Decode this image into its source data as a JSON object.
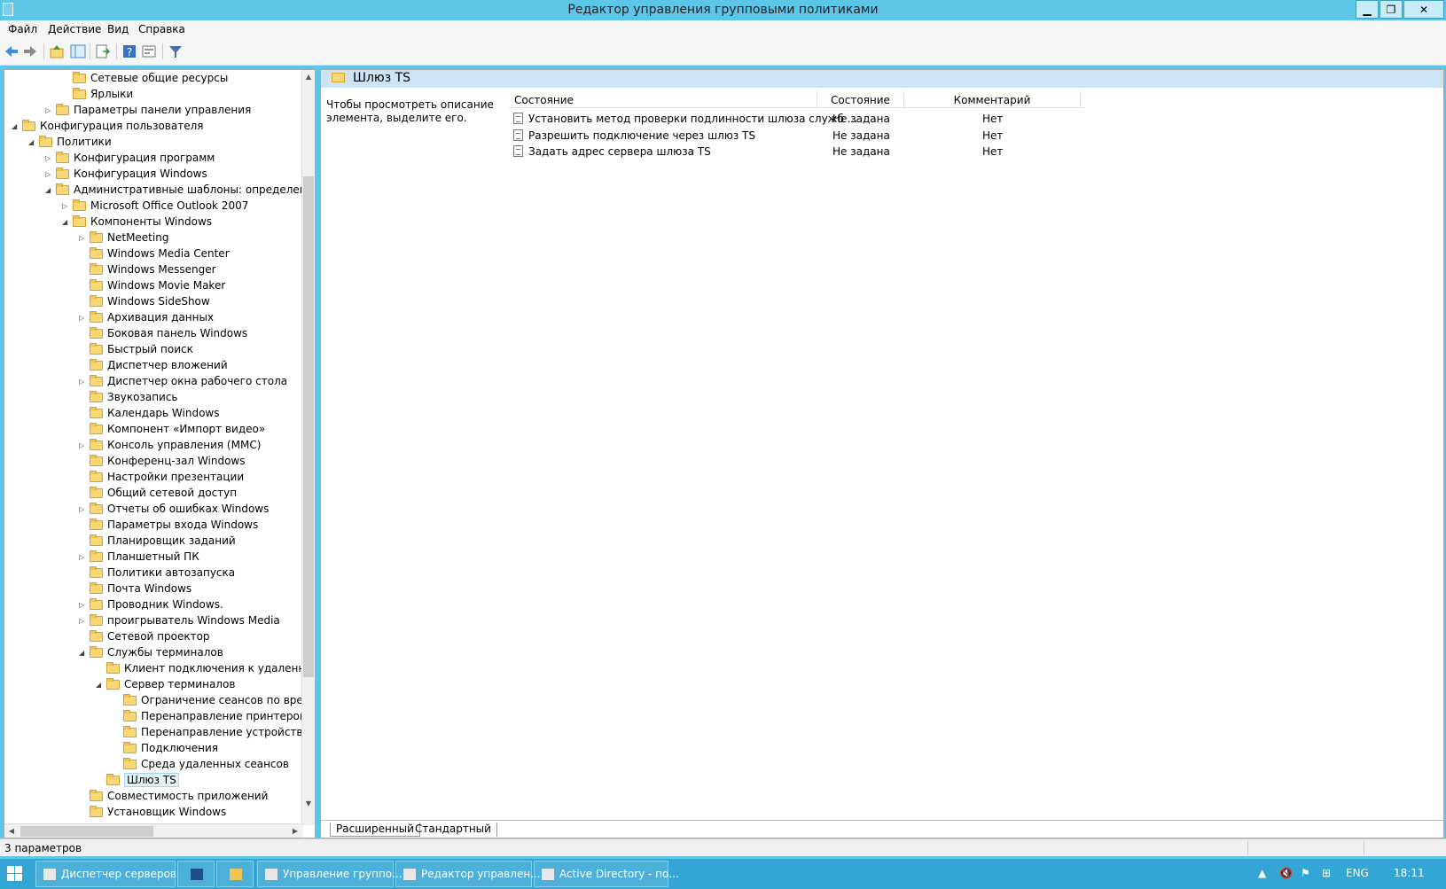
{
  "window": {
    "title": "Редактор управления групповыми политиками",
    "controls": {
      "min": "▁",
      "max": "❐",
      "close": "✕"
    }
  },
  "menu": [
    "Файл",
    "Действие",
    "Вид",
    "Справка"
  ],
  "tree": [
    {
      "label": "Сетевые общие ресурсы",
      "level": 4,
      "expander": "",
      "icon": "share-icon"
    },
    {
      "label": "Ярлыки",
      "level": 4,
      "expander": "",
      "icon": "shortcut-icon"
    },
    {
      "label": "Параметры панели управления",
      "level": 3,
      "expander": "▷",
      "icon": "control-panel-icon"
    },
    {
      "label": "Конфигурация пользователя",
      "level": 1,
      "expander": "◢",
      "icon": "user-config-icon"
    },
    {
      "label": "Политики",
      "level": 2,
      "expander": "◢",
      "icon": "folder-icon"
    },
    {
      "label": "Конфигурация программ",
      "level": 3,
      "expander": "▷",
      "icon": "folder-icon"
    },
    {
      "label": "Конфигурация Windows",
      "level": 3,
      "expander": "▷",
      "icon": "folder-icon"
    },
    {
      "label": "Административные шаблоны: определения п",
      "level": 3,
      "expander": "◢",
      "icon": "folder-icon"
    },
    {
      "label": "Microsoft Office Outlook 2007",
      "level": 4,
      "expander": "▷",
      "icon": "folder-icon"
    },
    {
      "label": "Компоненты Windows",
      "level": 4,
      "expander": "◢",
      "icon": "folder-icon"
    },
    {
      "label": "NetMeeting",
      "level": 5,
      "expander": "▷",
      "icon": "folder-icon"
    },
    {
      "label": "Windows Media Center",
      "level": 5,
      "expander": "",
      "icon": "folder-icon"
    },
    {
      "label": "Windows Messenger",
      "level": 5,
      "expander": "",
      "icon": "folder-icon"
    },
    {
      "label": "Windows Movie Maker",
      "level": 5,
      "expander": "",
      "icon": "folder-icon"
    },
    {
      "label": "Windows SideShow",
      "level": 5,
      "expander": "",
      "icon": "folder-icon"
    },
    {
      "label": "Архивация данных",
      "level": 5,
      "expander": "▷",
      "icon": "folder-icon"
    },
    {
      "label": "Боковая панель Windows",
      "level": 5,
      "expander": "",
      "icon": "folder-icon"
    },
    {
      "label": "Быстрый поиск",
      "level": 5,
      "expander": "",
      "icon": "folder-icon"
    },
    {
      "label": "Диспетчер вложений",
      "level": 5,
      "expander": "",
      "icon": "folder-icon"
    },
    {
      "label": "Диспетчер окна рабочего стола",
      "level": 5,
      "expander": "▷",
      "icon": "folder-icon"
    },
    {
      "label": "Звукозапись",
      "level": 5,
      "expander": "",
      "icon": "folder-icon"
    },
    {
      "label": "Календарь Windows",
      "level": 5,
      "expander": "",
      "icon": "folder-icon"
    },
    {
      "label": "Компонент «Импорт видео»",
      "level": 5,
      "expander": "",
      "icon": "folder-icon"
    },
    {
      "label": "Консоль управления (MMC)",
      "level": 5,
      "expander": "▷",
      "icon": "folder-icon"
    },
    {
      "label": "Конференц-зал Windows",
      "level": 5,
      "expander": "",
      "icon": "folder-icon"
    },
    {
      "label": "Настройки презентации",
      "level": 5,
      "expander": "",
      "icon": "folder-icon"
    },
    {
      "label": "Общий сетевой доступ",
      "level": 5,
      "expander": "",
      "icon": "folder-icon"
    },
    {
      "label": "Отчеты об ошибках Windows",
      "level": 5,
      "expander": "▷",
      "icon": "folder-icon"
    },
    {
      "label": "Параметры входа Windows",
      "level": 5,
      "expander": "",
      "icon": "folder-icon"
    },
    {
      "label": "Планировщик заданий",
      "level": 5,
      "expander": "",
      "icon": "folder-icon"
    },
    {
      "label": "Планшетный ПК",
      "level": 5,
      "expander": "▷",
      "icon": "folder-icon"
    },
    {
      "label": "Политики автозапуска",
      "level": 5,
      "expander": "",
      "icon": "folder-icon"
    },
    {
      "label": "Почта Windows",
      "level": 5,
      "expander": "",
      "icon": "folder-icon"
    },
    {
      "label": "Проводник Windows.",
      "level": 5,
      "expander": "▷",
      "icon": "folder-icon"
    },
    {
      "label": "проигрыватель Windows Media",
      "level": 5,
      "expander": "▷",
      "icon": "folder-icon"
    },
    {
      "label": "Сетевой проектор",
      "level": 5,
      "expander": "",
      "icon": "folder-icon"
    },
    {
      "label": "Службы терминалов",
      "level": 5,
      "expander": "◢",
      "icon": "folder-icon"
    },
    {
      "label": "Клиент подключения к удаленному",
      "level": 6,
      "expander": "",
      "icon": "folder-icon"
    },
    {
      "label": "Сервер терминалов",
      "level": 6,
      "expander": "◢",
      "icon": "folder-icon"
    },
    {
      "label": "Ограничение сеансов по времен",
      "level": 7,
      "expander": "",
      "icon": "folder-icon"
    },
    {
      "label": "Перенаправление принтеров",
      "level": 7,
      "expander": "",
      "icon": "folder-icon"
    },
    {
      "label": "Перенаправление устройств и р",
      "level": 7,
      "expander": "",
      "icon": "folder-icon"
    },
    {
      "label": "Подключения",
      "level": 7,
      "expander": "",
      "icon": "folder-icon"
    },
    {
      "label": "Среда удаленных сеансов",
      "level": 7,
      "expander": "",
      "icon": "folder-icon"
    },
    {
      "label": "Шлюз TS",
      "level": 6,
      "expander": "",
      "icon": "folder-icon",
      "selected": true
    },
    {
      "label": "Совместимость приложений",
      "level": 5,
      "expander": "",
      "icon": "folder-icon"
    },
    {
      "label": "Установщик Windows",
      "level": 5,
      "expander": "",
      "icon": "folder-icon"
    }
  ],
  "right": {
    "header_title": "Шлюз TS",
    "description": "Чтобы просмотреть описание элемента, выделите его.",
    "columns": [
      "Состояние",
      "Состояние",
      "Комментарий"
    ],
    "rows": [
      {
        "name": "Установить метод проверки подлинности шлюза служб ...",
        "state": "Не задана",
        "comment": "Нет"
      },
      {
        "name": "Разрешить подключение через шлюз TS",
        "state": "Не задана",
        "comment": "Нет"
      },
      {
        "name": "Задать адрес сервера шлюза TS",
        "state": "Не задана",
        "comment": "Нет"
      }
    ],
    "tabs": [
      "Расширенный",
      "Стандартный"
    ]
  },
  "status": {
    "text": "3 параметров"
  },
  "taskbar": {
    "items": [
      {
        "label": "Диспетчер серверов",
        "icon": "server-manager-icon"
      },
      {
        "label": "",
        "icon": "powershell-icon"
      },
      {
        "label": "",
        "icon": "explorer-icon"
      },
      {
        "label": "Управление группо...",
        "icon": "gpmc-icon"
      },
      {
        "label": "Редактор управлен...",
        "icon": "gpo-editor-icon"
      },
      {
        "label": "Active Directory - по...",
        "icon": "ad-icon"
      }
    ],
    "lang": "ENG",
    "time": "18:11"
  },
  "colors": {
    "titlebar": "#5bc6e8",
    "taskbar": "#34a6d6",
    "header": "#cde4f4",
    "folder": "#f8d876"
  }
}
